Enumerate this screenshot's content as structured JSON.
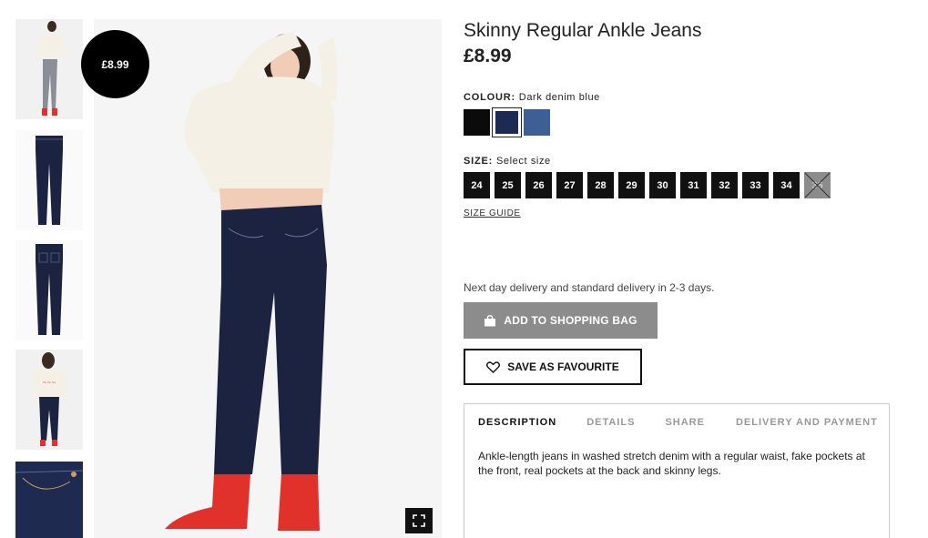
{
  "product": {
    "title": "Skinny Regular Ankle Jeans",
    "price": "£8.99",
    "badge_price": "£8.99"
  },
  "colour": {
    "label": "COLOUR:",
    "selected_name": "Dark denim blue",
    "swatches": [
      {
        "name": "Black",
        "color": "#0b0b0b"
      },
      {
        "name": "Dark denim blue",
        "color": "#1d2a54"
      },
      {
        "name": "Denim blue",
        "color": "#3d5f95"
      }
    ]
  },
  "size": {
    "label": "SIZE:",
    "prompt": "Select size",
    "options": [
      "24",
      "25",
      "26",
      "27",
      "28",
      "29",
      "30",
      "31",
      "32",
      "33",
      "34",
      "36"
    ],
    "unavailable": [
      "36"
    ],
    "guide_label": "SIZE GUIDE"
  },
  "delivery_text": "Next day delivery and standard delivery in 2-3 days.",
  "buttons": {
    "add_to_bag": "ADD TO SHOPPING BAG",
    "save_favourite": "SAVE AS FAVOURITE"
  },
  "tabs": {
    "items": [
      "DESCRIPTION",
      "DETAILS",
      "SHARE",
      "DELIVERY AND PAYMENT"
    ],
    "active": "DESCRIPTION",
    "description": "Ankle-length jeans in washed stretch denim with a regular waist, fake pockets at the front, real pockets at the back and skinny legs."
  },
  "icons": {
    "bag": "shopping-bag-icon",
    "heart": "heart-icon",
    "fullscreen": "fullscreen-icon"
  },
  "colors": {
    "denim": "#1b2340",
    "boot_red": "#e0312a",
    "sweater": "#f4f0e6",
    "button_grey": "#8c8c8c"
  }
}
